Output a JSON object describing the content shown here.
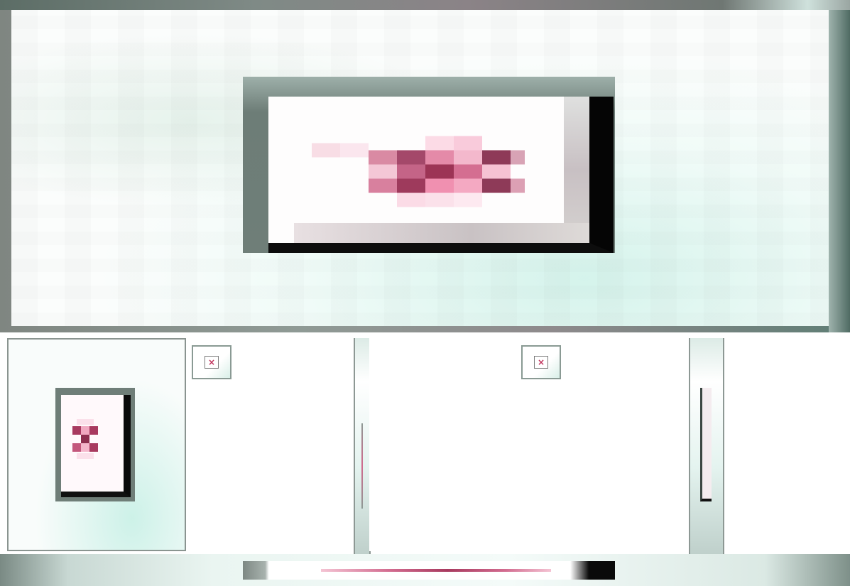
{
  "viewer": {
    "main_image": {
      "icon": "broken-image-icon",
      "state": "image-failed-to-load"
    },
    "thumbnails": [
      {
        "icon": "broken-image-icon",
        "selected": true
      },
      {
        "icon": "broken-image-icon",
        "selected": false
      },
      {
        "icon": "broken-image-icon",
        "selected": false
      },
      {
        "icon": "broken-image-icon",
        "selected": false
      }
    ],
    "tiny_icon_glyph": "×"
  },
  "colors": {
    "frame": "#6f7e78",
    "accent_pink": "#c0305a",
    "mint": "#d6f3ea"
  }
}
